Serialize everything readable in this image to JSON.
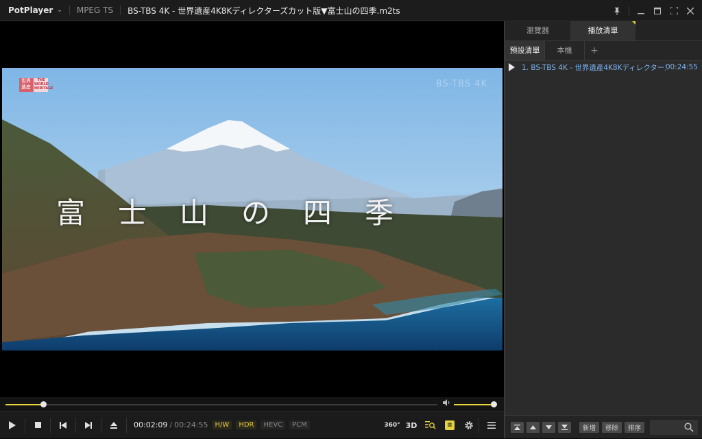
{
  "titlebar": {
    "app_name": "PotPlayer",
    "format": "MPEG TS",
    "file_title": "BS-TBS 4K - 世界遺産4K8Kディレクターズカット版▼富士山の四季.m2ts"
  },
  "video": {
    "subtitle": "富士山の四季",
    "logo_left_top": "世界",
    "logo_left_bottom": "遺産",
    "logo_right_top": "THE",
    "logo_right_bottom": "WORLD HERITAGE",
    "watermark": "BS-TBS 4K"
  },
  "playback": {
    "current_time": "00:02:09",
    "separator": "/",
    "total_time": "00:24:55",
    "position_fraction": 0.087,
    "volume_fraction": 1.0,
    "tags": {
      "hw": "H/W",
      "hdr": "HDR",
      "hevc": "HEVC",
      "pcm": "PCM"
    },
    "btn_360": "360°",
    "btn_3d": "3D"
  },
  "panel": {
    "tabs": [
      "瀏覽器",
      "播放清單"
    ],
    "subtabs": [
      "預設清單",
      "本機",
      "+"
    ],
    "items": [
      {
        "title": "1. BS-TBS 4K - 世界遺產4K8Kディレクターズ...",
        "duration": "00:24:55"
      }
    ],
    "buttons": {
      "new": "新增",
      "remove": "移除",
      "sort": "排序"
    }
  },
  "colors": {
    "accent": "#e5d23c",
    "playlist_text": "#7fb3ee"
  }
}
